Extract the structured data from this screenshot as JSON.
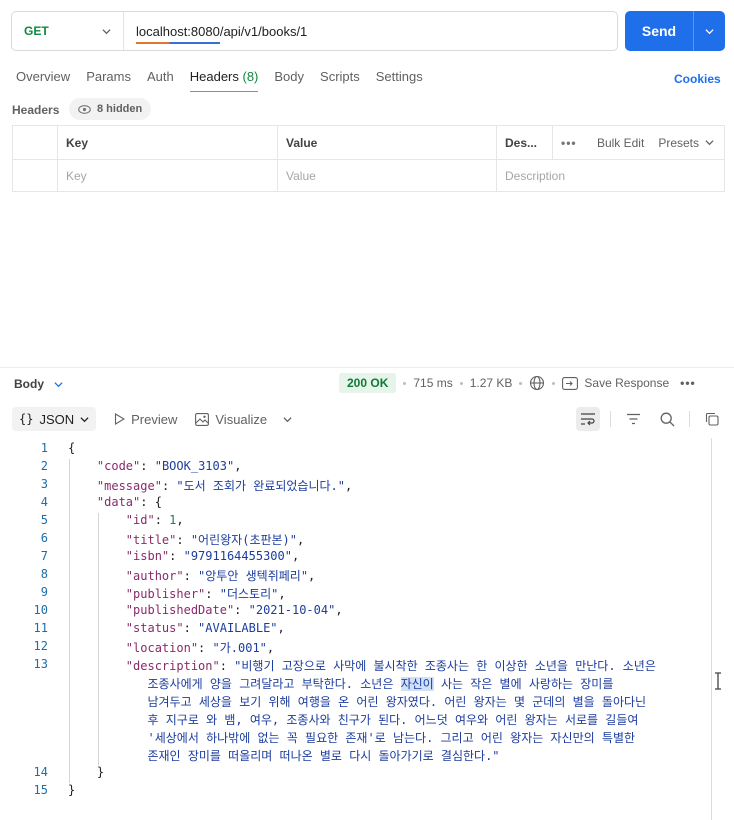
{
  "request": {
    "method": "GET",
    "url": "localhost:8080/api/v1/books/1",
    "send_label": "Send"
  },
  "tabs": [
    {
      "label": "Overview"
    },
    {
      "label": "Params"
    },
    {
      "label": "Auth"
    },
    {
      "label": "Headers",
      "count": "(8)",
      "active": true
    },
    {
      "label": "Body"
    },
    {
      "label": "Scripts"
    },
    {
      "label": "Settings"
    }
  ],
  "cookies_label": "Cookies",
  "headers_section": {
    "title": "Headers",
    "hidden_label": "8 hidden",
    "columns": [
      "Key",
      "Value",
      "Des..."
    ],
    "bulk_edit": "Bulk Edit",
    "presets": "Presets",
    "placeholders": {
      "key": "Key",
      "value": "Value",
      "description": "Description"
    }
  },
  "response": {
    "title": "Body",
    "status": "200 OK",
    "time": "715 ms",
    "size": "1.27 KB",
    "save_label": "Save Response",
    "format": "JSON",
    "preview": "Preview",
    "visualize": "Visualize"
  },
  "code_lines": [
    {
      "n": "1",
      "segs": [
        {
          "t": "p",
          "v": "{"
        }
      ]
    },
    {
      "n": "2",
      "segs": [
        {
          "t": "p",
          "v": "    "
        },
        {
          "t": "k",
          "v": "\"code\""
        },
        {
          "t": "p",
          "v": ": "
        },
        {
          "t": "s",
          "v": "\"BOOK_3103\""
        },
        {
          "t": "p",
          "v": ","
        }
      ]
    },
    {
      "n": "3",
      "segs": [
        {
          "t": "p",
          "v": "    "
        },
        {
          "t": "k",
          "v": "\"message\""
        },
        {
          "t": "p",
          "v": ": "
        },
        {
          "t": "s",
          "v": "\"도서 조회가 완료되었습니다.\""
        },
        {
          "t": "p",
          "v": ","
        }
      ]
    },
    {
      "n": "4",
      "segs": [
        {
          "t": "p",
          "v": "    "
        },
        {
          "t": "k",
          "v": "\"data\""
        },
        {
          "t": "p",
          "v": ": {"
        }
      ]
    },
    {
      "n": "5",
      "segs": [
        {
          "t": "p",
          "v": "        "
        },
        {
          "t": "k",
          "v": "\"id\""
        },
        {
          "t": "p",
          "v": ": "
        },
        {
          "t": "n",
          "v": "1"
        },
        {
          "t": "p",
          "v": ","
        }
      ]
    },
    {
      "n": "6",
      "segs": [
        {
          "t": "p",
          "v": "        "
        },
        {
          "t": "k",
          "v": "\"title\""
        },
        {
          "t": "p",
          "v": ": "
        },
        {
          "t": "s",
          "v": "\"어린왕자(초판본)\""
        },
        {
          "t": "p",
          "v": ","
        }
      ]
    },
    {
      "n": "7",
      "segs": [
        {
          "t": "p",
          "v": "        "
        },
        {
          "t": "k",
          "v": "\"isbn\""
        },
        {
          "t": "p",
          "v": ": "
        },
        {
          "t": "s",
          "v": "\"9791164455300\""
        },
        {
          "t": "p",
          "v": ","
        }
      ]
    },
    {
      "n": "8",
      "segs": [
        {
          "t": "p",
          "v": "        "
        },
        {
          "t": "k",
          "v": "\"author\""
        },
        {
          "t": "p",
          "v": ": "
        },
        {
          "t": "s",
          "v": "\"앙투안 생텍쥐페리\""
        },
        {
          "t": "p",
          "v": ","
        }
      ]
    },
    {
      "n": "9",
      "segs": [
        {
          "t": "p",
          "v": "        "
        },
        {
          "t": "k",
          "v": "\"publisher\""
        },
        {
          "t": "p",
          "v": ": "
        },
        {
          "t": "s",
          "v": "\"더스토리\""
        },
        {
          "t": "p",
          "v": ","
        }
      ]
    },
    {
      "n": "10",
      "segs": [
        {
          "t": "p",
          "v": "        "
        },
        {
          "t": "k",
          "v": "\"publishedDate\""
        },
        {
          "t": "p",
          "v": ": "
        },
        {
          "t": "s",
          "v": "\"2021-10-04\""
        },
        {
          "t": "p",
          "v": ","
        }
      ]
    },
    {
      "n": "11",
      "segs": [
        {
          "t": "p",
          "v": "        "
        },
        {
          "t": "k",
          "v": "\"status\""
        },
        {
          "t": "p",
          "v": ": "
        },
        {
          "t": "s",
          "v": "\"AVAILABLE\""
        },
        {
          "t": "p",
          "v": ","
        }
      ]
    },
    {
      "n": "12",
      "segs": [
        {
          "t": "p",
          "v": "        "
        },
        {
          "t": "k",
          "v": "\"location\""
        },
        {
          "t": "p",
          "v": ": "
        },
        {
          "t": "s",
          "v": "\"가.001\""
        },
        {
          "t": "p",
          "v": ","
        }
      ]
    },
    {
      "n": "13",
      "segs": [
        {
          "t": "p",
          "v": "        "
        },
        {
          "t": "k",
          "v": "\"description\""
        },
        {
          "t": "p",
          "v": ": "
        },
        {
          "t": "s",
          "v": "\"비행기 고장으로 사막에 불시착한 조종사는 한 이상한 소년을 만난다. 소년은"
        }
      ]
    },
    {
      "n": "",
      "segs": [
        {
          "t": "s",
          "v": "           조종사에게 양을 그려달라고 부탁한다. 소년은 "
        },
        {
          "t": "sel",
          "v": "자신이"
        },
        {
          "t": "s",
          "v": " 사는 작은 별에 사랑하는 장미를"
        }
      ]
    },
    {
      "n": "",
      "segs": [
        {
          "t": "s",
          "v": "           남겨두고 세상을 보기 위해 여행을 온 어린 왕자였다. 어린 왕자는 몇 군데의 별을 돌아다닌"
        }
      ]
    },
    {
      "n": "",
      "segs": [
        {
          "t": "s",
          "v": "           후 지구로 와 뱀, 여우, 조종사와 친구가 된다. 어느덧 여우와 어린 왕자는 서로를 길들여"
        }
      ]
    },
    {
      "n": "",
      "segs": [
        {
          "t": "s",
          "v": "           '세상에서 하나밖에 없는 꼭 필요한 존재'로 남는다. 그리고 어린 왕자는 자신만의 특별한"
        }
      ]
    },
    {
      "n": "",
      "segs": [
        {
          "t": "s",
          "v": "           존재인 장미를 떠올리며 떠나온 별로 다시 돌아가기로 결심한다.\""
        }
      ]
    },
    {
      "n": "14",
      "segs": [
        {
          "t": "p",
          "v": "    }"
        }
      ]
    },
    {
      "n": "15",
      "segs": [
        {
          "t": "p",
          "v": "}"
        }
      ]
    }
  ]
}
